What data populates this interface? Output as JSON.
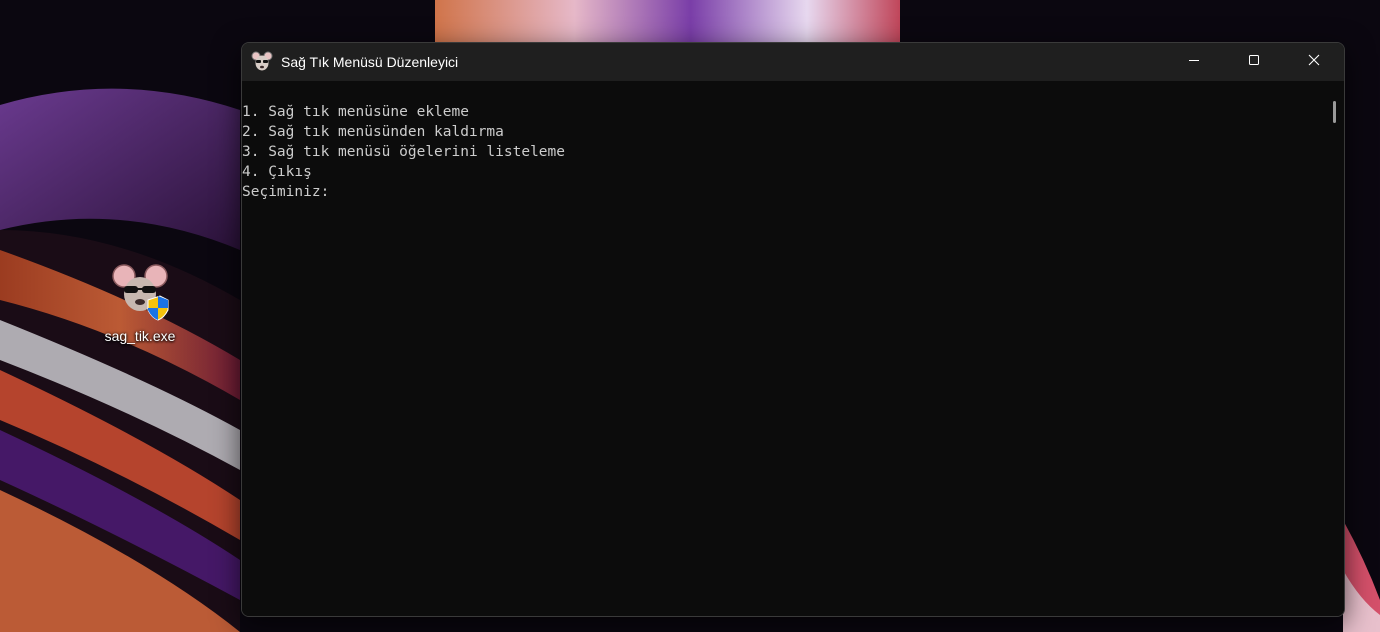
{
  "desktop": {
    "icon": {
      "label": "sag_tik.exe",
      "image": "mouse-with-sunglasses-shield-icon"
    }
  },
  "window": {
    "title": "Sağ Tık Menüsü Düzenleyici",
    "app_icon": "mouse-icon",
    "buttons": {
      "minimize": "minimize-icon",
      "maximize": "maximize-icon",
      "close": "close-icon"
    },
    "console_lines": [
      "1. Sağ tık menüsüne ekleme",
      "2. Sağ tık menüsünden kaldırma",
      "3. Sağ tık menüsü öğelerini listeleme",
      "4. Çıkış",
      "Seçiminiz:"
    ]
  },
  "colors": {
    "console_bg": "#0c0c0c",
    "console_text": "#cccccc",
    "titlebar_bg": "#1f1f1f"
  }
}
